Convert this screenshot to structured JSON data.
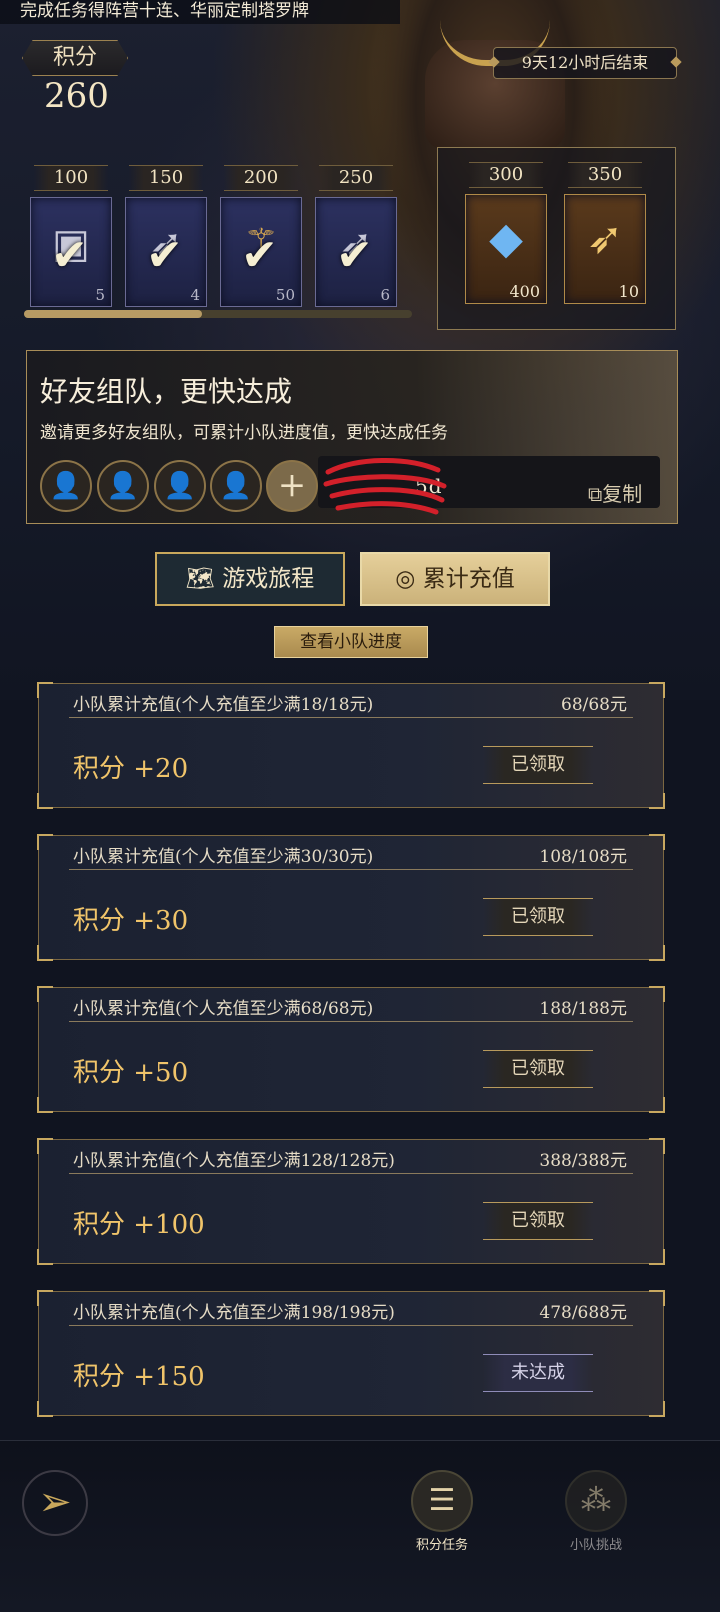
{
  "header": {
    "banner": "完成任务得阵营十连、华丽定制塔罗牌",
    "score_label": "积分",
    "score_value": "260",
    "timer": "9天12小时后结束"
  },
  "rewards": [
    {
      "cost": "100",
      "qty": "5",
      "icon": "chest-icon",
      "claimed": true
    },
    {
      "cost": "150",
      "qty": "4",
      "icon": "feather-icon",
      "claimed": true
    },
    {
      "cost": "200",
      "qty": "50",
      "icon": "scepter-icon",
      "claimed": true
    },
    {
      "cost": "250",
      "qty": "6",
      "icon": "feather-icon",
      "claimed": true
    },
    {
      "cost": "300",
      "qty": "400",
      "icon": "crystal-icon",
      "claimed": false
    },
    {
      "cost": "350",
      "qty": "10",
      "icon": "golden-feather-icon",
      "claimed": false
    }
  ],
  "progress_fraction": 0.46,
  "team": {
    "title": "好友组队，更快达成",
    "description": "邀请更多好友组队，可累计小队进度值，更快达成任务",
    "code_visible": "5d",
    "copy_label": "复制"
  },
  "tabs": {
    "journey": "游戏旅程",
    "recharge": "累计充值",
    "active": "recharge"
  },
  "view_progress_label": "查看小队进度",
  "tasks": [
    {
      "title": "小队累计充值(个人充值至少满18/18元)",
      "progress": "68/68元",
      "reward": "积分 +20",
      "status": "已领取",
      "done": true
    },
    {
      "title": "小队累计充值(个人充值至少满30/30元)",
      "progress": "108/108元",
      "reward": "积分 +30",
      "status": "已领取",
      "done": true
    },
    {
      "title": "小队累计充值(个人充值至少满68/68元)",
      "progress": "188/188元",
      "reward": "积分 +50",
      "status": "已领取",
      "done": true
    },
    {
      "title": "小队累计充值(个人充值至少满128/128元)",
      "progress": "388/388元",
      "reward": "积分 +100",
      "status": "已领取",
      "done": true
    },
    {
      "title": "小队累计充值(个人充值至少满198/198元)",
      "progress": "478/688元",
      "reward": "积分 +150",
      "status": "未达成",
      "done": false
    }
  ],
  "bottom_nav": {
    "points_tasks": "积分任务",
    "team_challenge": "小队挑战"
  },
  "colors": {
    "accent_gold": "#c9a85c",
    "reward_text": "#f0c46a",
    "background": "#101420"
  }
}
